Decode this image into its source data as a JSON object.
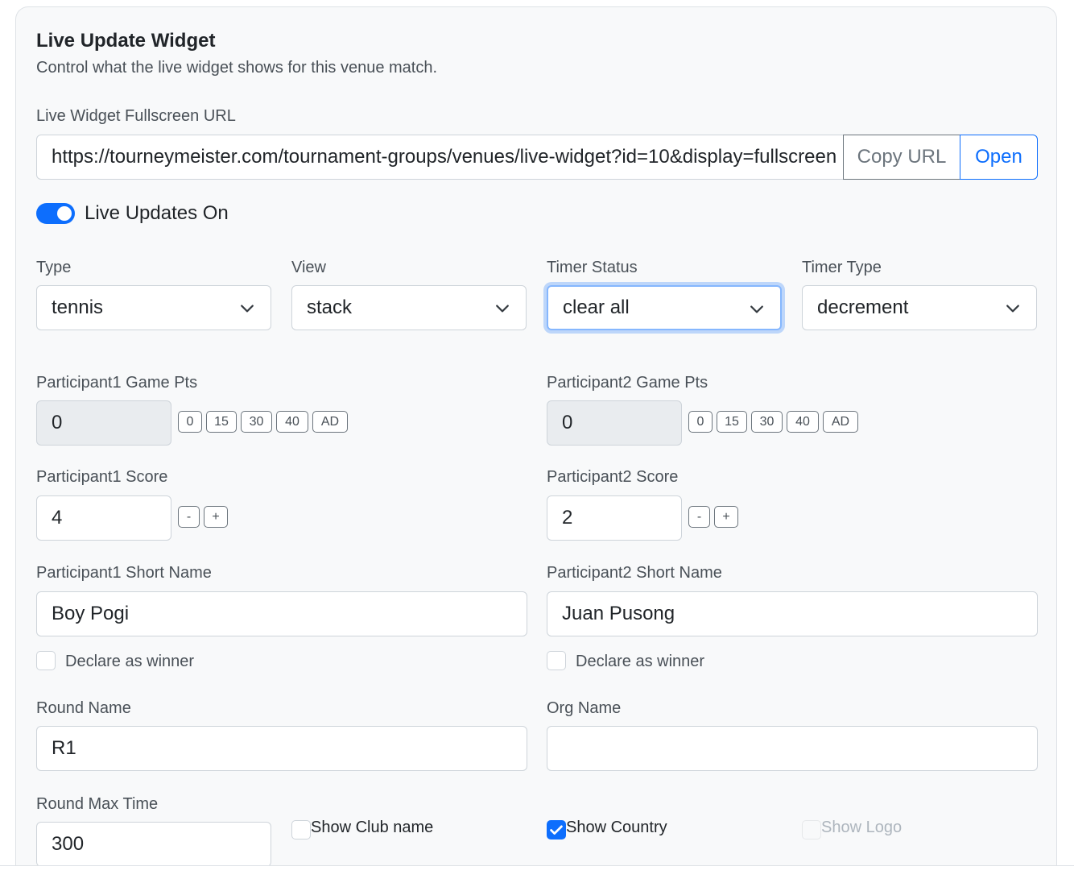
{
  "header": {
    "title": "Live Update Widget",
    "subtitle": "Control what the live widget shows for this venue match."
  },
  "url_section": {
    "label": "Live Widget Fullscreen URL",
    "value": "https://tourneymeister.com/tournament-groups/venues/live-widget?id=10&display=fullscreen",
    "copy_label": "Copy URL",
    "open_label": "Open"
  },
  "live_toggle": {
    "label": "Live Updates On",
    "on": true
  },
  "selects": {
    "type": {
      "label": "Type",
      "value": "tennis"
    },
    "view": {
      "label": "View",
      "value": "stack"
    },
    "timer_status": {
      "label": "Timer Status",
      "value": "clear all"
    },
    "timer_type": {
      "label": "Timer Type",
      "value": "decrement"
    }
  },
  "participant1": {
    "game_pts_label": "Participant1 Game Pts",
    "game_pts_value": "0",
    "game_pts_options": [
      "0",
      "15",
      "30",
      "40",
      "AD"
    ],
    "score_label": "Participant1 Score",
    "score_value": "4",
    "score_minus": "-",
    "score_plus": "+",
    "short_name_label": "Participant1 Short Name",
    "short_name_value": "Boy Pogi",
    "winner_label": "Declare as winner",
    "winner_checked": false
  },
  "participant2": {
    "game_pts_label": "Participant2 Game Pts",
    "game_pts_value": "0",
    "game_pts_options": [
      "0",
      "15",
      "30",
      "40",
      "AD"
    ],
    "score_label": "Participant2 Score",
    "score_value": "2",
    "score_minus": "-",
    "score_plus": "+",
    "short_name_label": "Participant2 Short Name",
    "short_name_value": "Juan Pusong",
    "winner_label": "Declare as winner",
    "winner_checked": false
  },
  "round": {
    "name_label": "Round Name",
    "name_value": "R1",
    "org_label": "Org Name",
    "org_value": "",
    "max_time_label": "Round Max Time",
    "max_time_value": "300"
  },
  "options": {
    "show_club_name": {
      "label": "Show Club name",
      "checked": false
    },
    "show_country": {
      "label": "Show Country",
      "checked": true
    },
    "show_logo": {
      "label": "Show Logo",
      "checked": false,
      "disabled": true
    }
  },
  "colors": {
    "primary": "#0d6efd",
    "card_bg": "#f8f9fa",
    "border": "#ced4da",
    "muted_text": "#495057"
  }
}
